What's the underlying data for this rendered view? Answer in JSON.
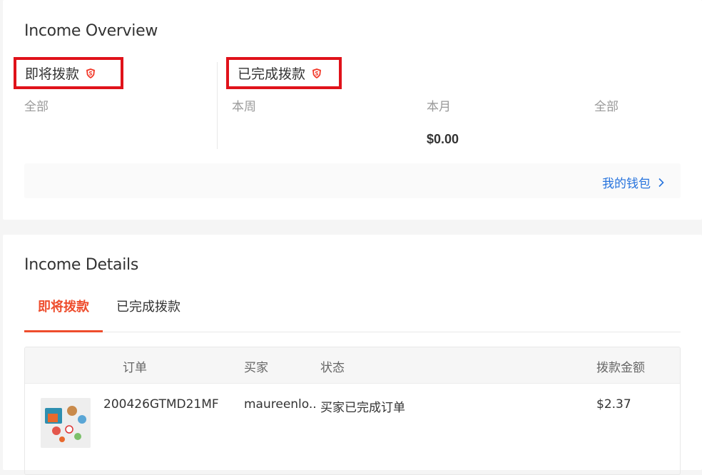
{
  "overview": {
    "title": "Income Overview",
    "upcoming": {
      "label": "即将拨款",
      "periods": [
        "全部"
      ]
    },
    "completed": {
      "label": "已完成拨款",
      "periods": [
        "本周",
        "本月",
        "全部"
      ],
      "month_amount": "$0.00"
    },
    "wallet_link": "我的钱包"
  },
  "details": {
    "title": "Income Details",
    "tabs": [
      {
        "label": "即将拨款",
        "active": true
      },
      {
        "label": "已完成拨款",
        "active": false
      }
    ],
    "table": {
      "columns": [
        "订单",
        "买家",
        "状态",
        "拨款金额"
      ],
      "rows": [
        {
          "order": "200426GTMD21MF",
          "buyer": "maureenlo...",
          "status": "买家已完成订单",
          "amount": "$2.37"
        }
      ]
    }
  },
  "colors": {
    "accent": "#ee4d2d",
    "link": "#2673dd",
    "highlight_border": "#e0121a"
  },
  "icons": {
    "shield": "shield-icon",
    "chevron": "chevron-right-icon",
    "product_thumbnail": "product-thumbnail"
  }
}
